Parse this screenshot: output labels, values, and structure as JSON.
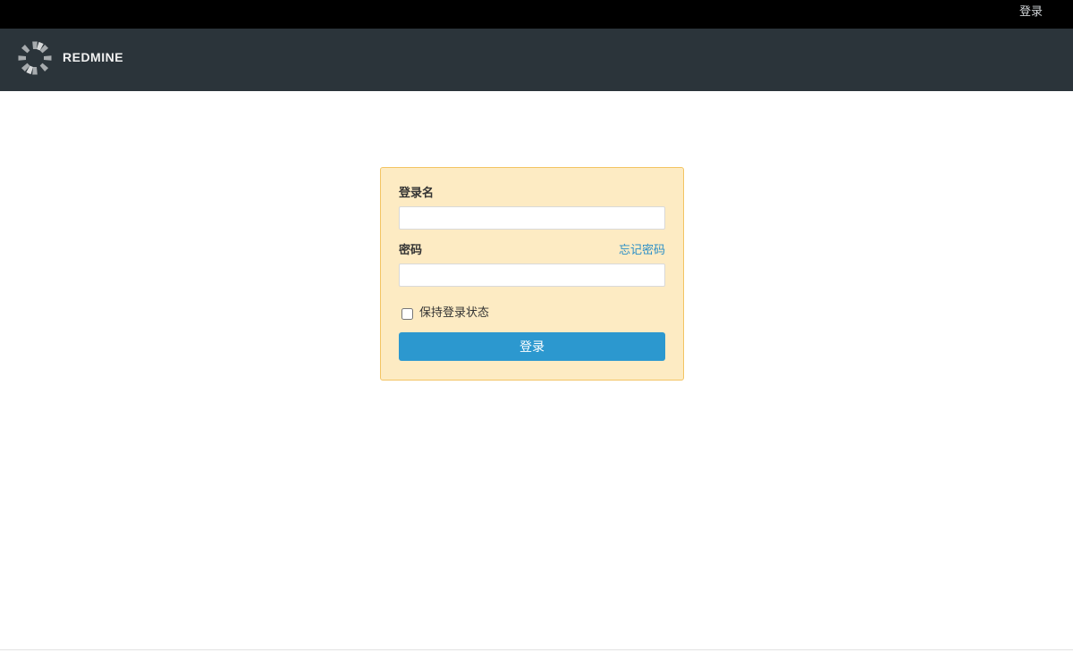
{
  "topbar": {
    "login_link": "登录"
  },
  "header": {
    "brand": "REDMINE",
    "logo_icon": "redmine-logo-icon",
    "background": "#2b343a"
  },
  "login_form": {
    "username_label": "登录名",
    "username_value": "",
    "password_label": "密码",
    "password_value": "",
    "forgot_password": "忘记密码",
    "remember_me": "保持登录状态",
    "remember_checked": false,
    "submit_label": "登录",
    "box_background": "#fdebc3",
    "box_border": "#f3c463",
    "button_color": "#2c98cf",
    "link_color": "#2b8fc7"
  }
}
